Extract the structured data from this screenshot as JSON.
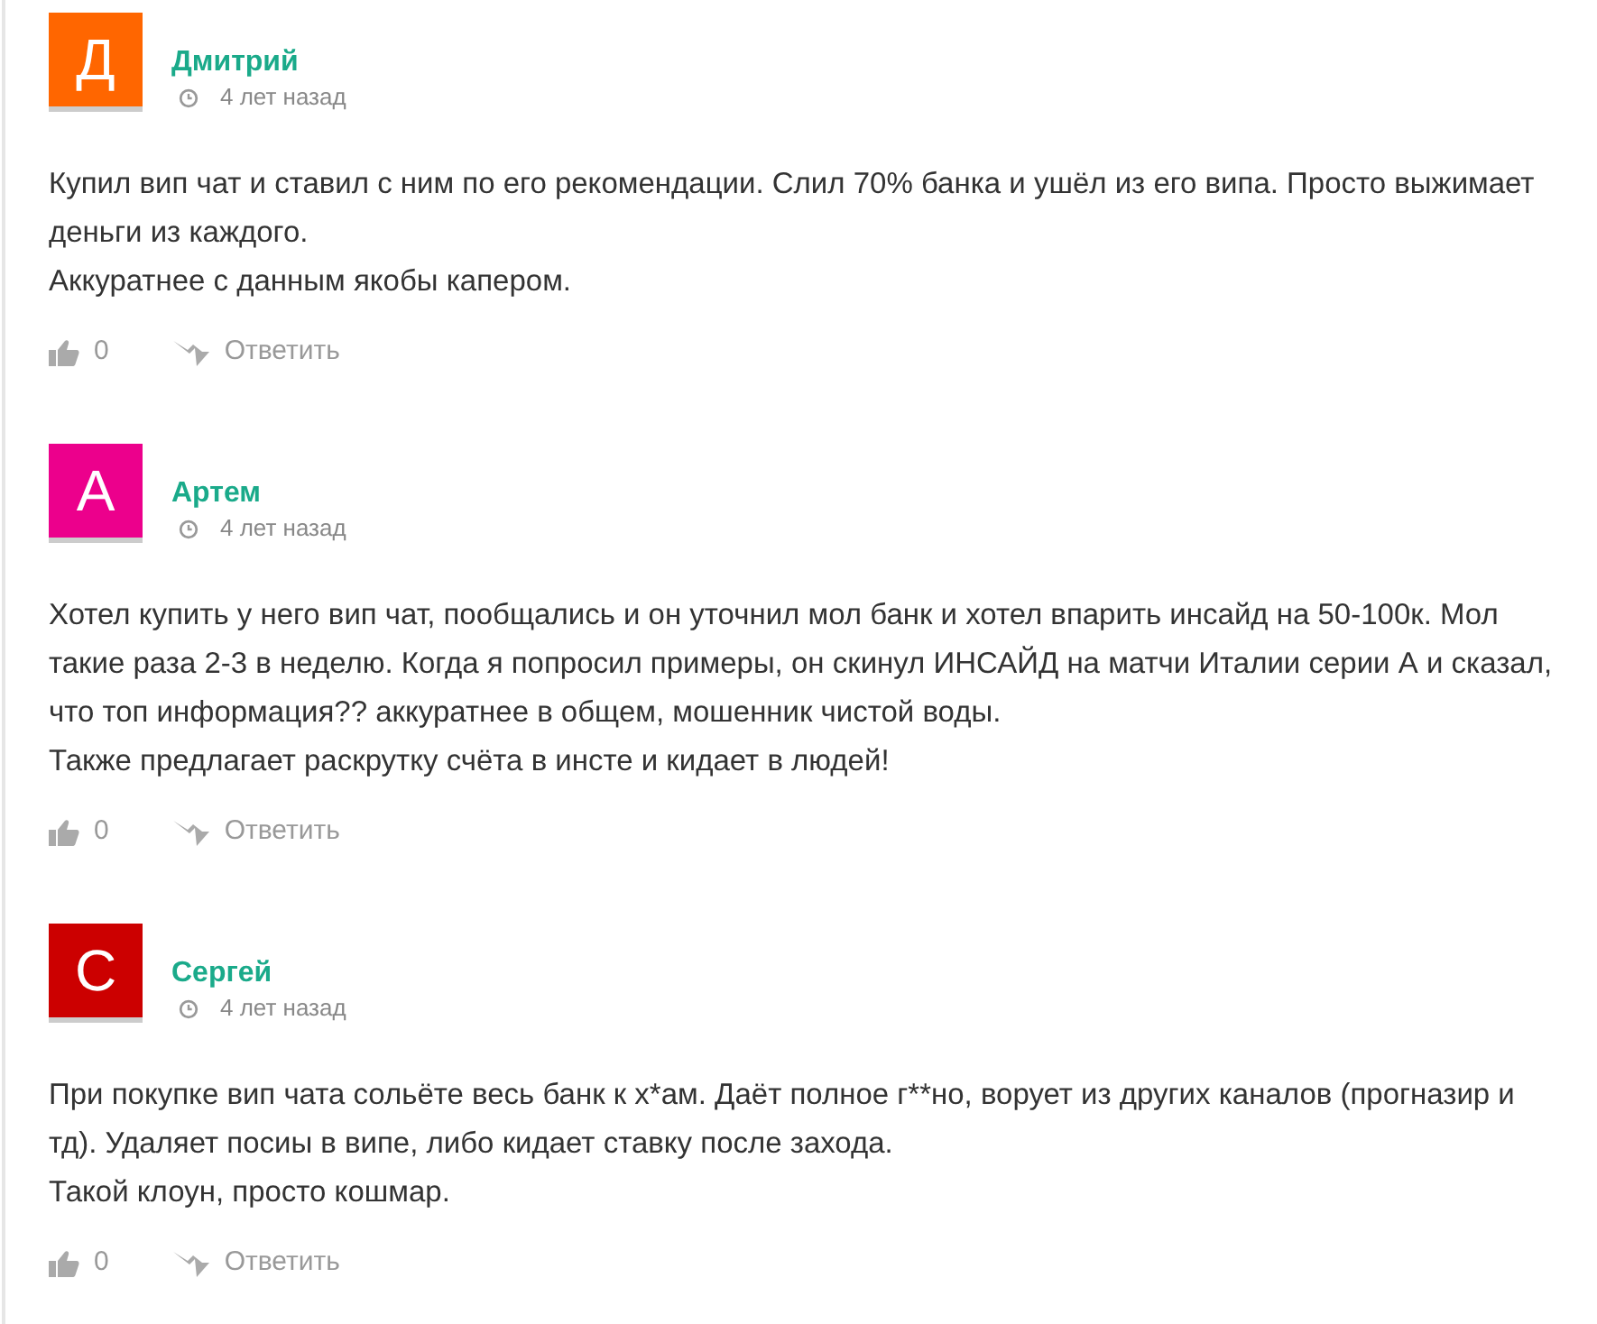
{
  "comments": [
    {
      "author": "Дмитрий",
      "initial": "Д",
      "color": "#ff6600",
      "time": "4 лет назад",
      "paragraphs": [
        "Купил вип чат и ставил с ним по его рекомендации. Слил 70% банка и ушёл из его випа. Просто выжимает деньги из каждого.",
        "Аккуратнее с данным якобы капером."
      ],
      "likes": "0",
      "reply": "Ответить"
    },
    {
      "author": "Артем",
      "initial": "А",
      "color": "#ec008c",
      "time": "4 лет назад",
      "paragraphs": [
        "Хотел купить у него вип чат, пообщались и он уточнил мол банк и хотел впарить инсайд на 50-100к. Мол такие раза 2-3 в неделю. Когда я попросил примеры, он скинул ИНСАЙД на матчи Италии серии А и сказал, что топ информация?? аккуратнее в общем, мошенник чистой воды.",
        "Также предлагает раскрутку счёта в инсте и кидает в людей!"
      ],
      "likes": "0",
      "reply": "Ответить"
    },
    {
      "author": "Сергей",
      "initial": "С",
      "color": "#cc0000",
      "time": "4 лет назад",
      "paragraphs": [
        "При покупке вип чата сольёте весь банк к х*ам. Даёт полное г**но, ворует из других каналов (прогназир и тд). Удаляет посиы в випе, либо кидает ставку после захода.",
        "Такой клоун, просто кошмар."
      ],
      "likes": "0",
      "reply": "Ответить"
    }
  ]
}
